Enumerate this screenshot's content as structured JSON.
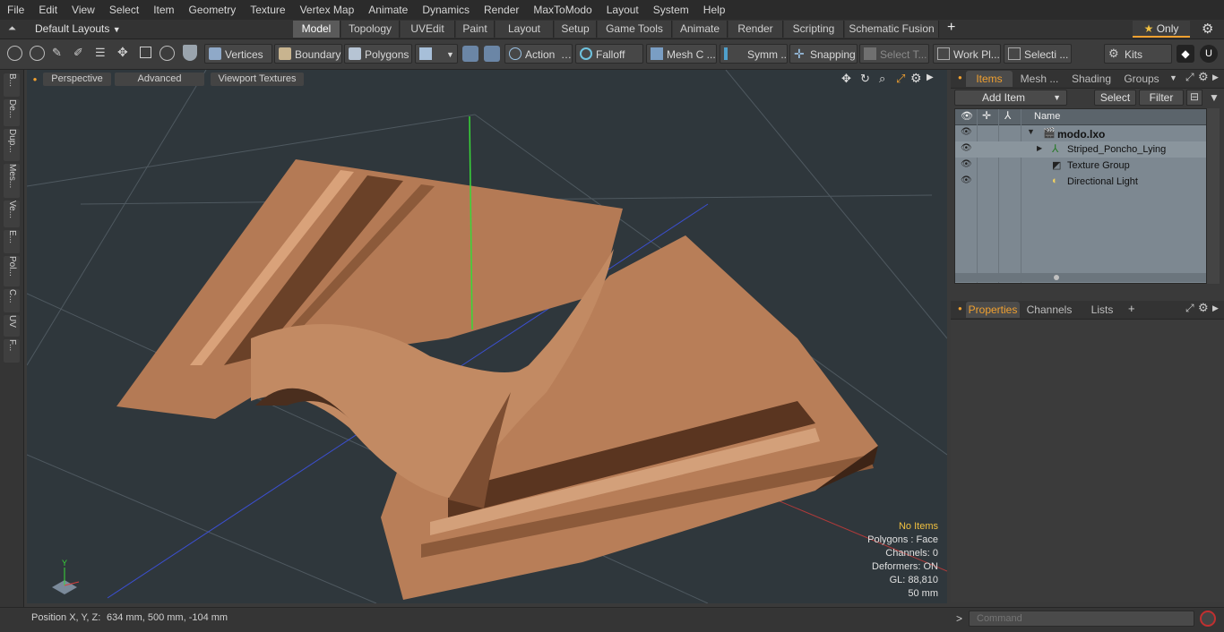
{
  "menu": [
    "File",
    "Edit",
    "View",
    "Select",
    "Item",
    "Geometry",
    "Texture",
    "Vertex Map",
    "Animate",
    "Dynamics",
    "Render",
    "MaxToModo",
    "Layout",
    "System",
    "Help"
  ],
  "layout_selector": "Default Layouts",
  "layout_tabs": [
    "Model",
    "Topology",
    "UVEdit",
    "Paint",
    "Layout",
    "Setup",
    "Game Tools",
    "Animate",
    "Render",
    "Scripting",
    "Schematic Fusion"
  ],
  "layout_plus": "+",
  "only_label": "Only",
  "toolbar": {
    "vertices": "Vertices",
    "boundary": "Boundary",
    "polygons": "Polygons",
    "action": "Action",
    "falloff": "Falloff",
    "meshc": "Mesh C ...",
    "symm": "Symm ...",
    "snapping": "Snapping",
    "selectt": "Select T...",
    "workpl": "Work Pl...",
    "selecti": "Selecti ...",
    "kits": "Kits"
  },
  "left_tabs": [
    "B...",
    "De...",
    "Dup...",
    "Mes...",
    "Ve...",
    "E...",
    "Pol...",
    "C...",
    "UV",
    "F..."
  ],
  "viewport": {
    "tabs": [
      "Perspective",
      "Advanced",
      "Viewport Textures"
    ],
    "stats": {
      "items": "No Items",
      "polygons": "Polygons : Face",
      "channels": "Channels: 0",
      "deformers": "Deformers: ON",
      "gl": "GL: 88,810",
      "scale": "50 mm"
    },
    "axis_y": "Y"
  },
  "items_panel": {
    "tabs": [
      "Items",
      "Mesh ...",
      "Shading",
      "Groups"
    ],
    "add_item": "Add Item",
    "select": "Select",
    "filter": "Filter",
    "name_header": "Name",
    "tree": [
      "modo.lxo",
      "Striped_Poncho_Lying",
      "Texture Group",
      "Directional Light"
    ]
  },
  "props_panel": {
    "tabs": [
      "Properties",
      "Channels",
      "Lists"
    ],
    "plus": "+"
  },
  "status": {
    "position_label": "Position X, Y, Z:",
    "position_value": "634 mm, 500 mm, -104 mm",
    "command_placeholder": "Command",
    "prompt": ">"
  },
  "colors": {
    "accent": "#f0a030",
    "viewport_bg": "#2f373c",
    "cloth": "#b47a55"
  }
}
